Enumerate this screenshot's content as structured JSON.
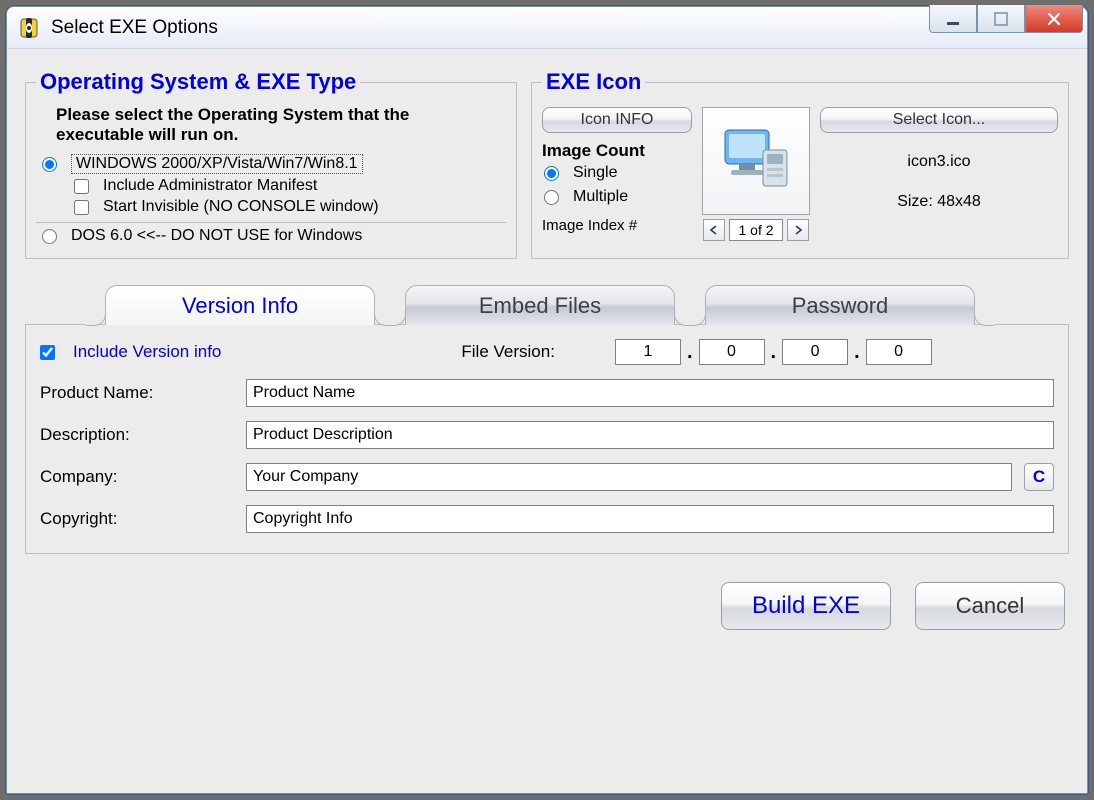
{
  "window": {
    "title": "Select EXE Options"
  },
  "os_group": {
    "title": "Operating System & EXE Type",
    "instruction": "Please select the Operating System that the executable will run on.",
    "windows_label": "WINDOWS   2000/XP/Vista/Win7/Win8.1",
    "windows_selected": true,
    "admin_label": "Include Administrator Manifest",
    "admin_checked": false,
    "invisible_label": "Start Invisible   (NO CONSOLE window)",
    "invisible_checked": false,
    "dos_label": "DOS 6.0 <<-- DO NOT USE for Windows",
    "dos_selected": false
  },
  "icon_group": {
    "title": "EXE Icon",
    "info_btn": "Icon INFO",
    "image_count_header": "Image Count",
    "single_label": "Single",
    "single_selected": true,
    "multiple_label": "Multiple",
    "multiple_selected": false,
    "index_label": "Image Index #",
    "index_value": "1 of 2",
    "select_btn": "Select Icon...",
    "filename": "icon3.ico",
    "size_label": "Size: 48x48"
  },
  "tabs": {
    "version": "Version Info",
    "embed": "Embed Files",
    "password": "Password",
    "active": "version"
  },
  "version_info": {
    "include_label": "Include Version info",
    "include_checked": true,
    "file_version_label": "File Version:",
    "version_parts": [
      "1",
      "0",
      "0",
      "0"
    ],
    "product_name_label": "Product Name:",
    "product_name": "Product Name",
    "description_label": "Description:",
    "description": "Product Description",
    "company_label": "Company:",
    "company": "Your Company",
    "company_btn": "C",
    "copyright_label": "Copyright:",
    "copyright": "Copyright Info"
  },
  "buttons": {
    "build": "Build EXE",
    "cancel": "Cancel"
  }
}
